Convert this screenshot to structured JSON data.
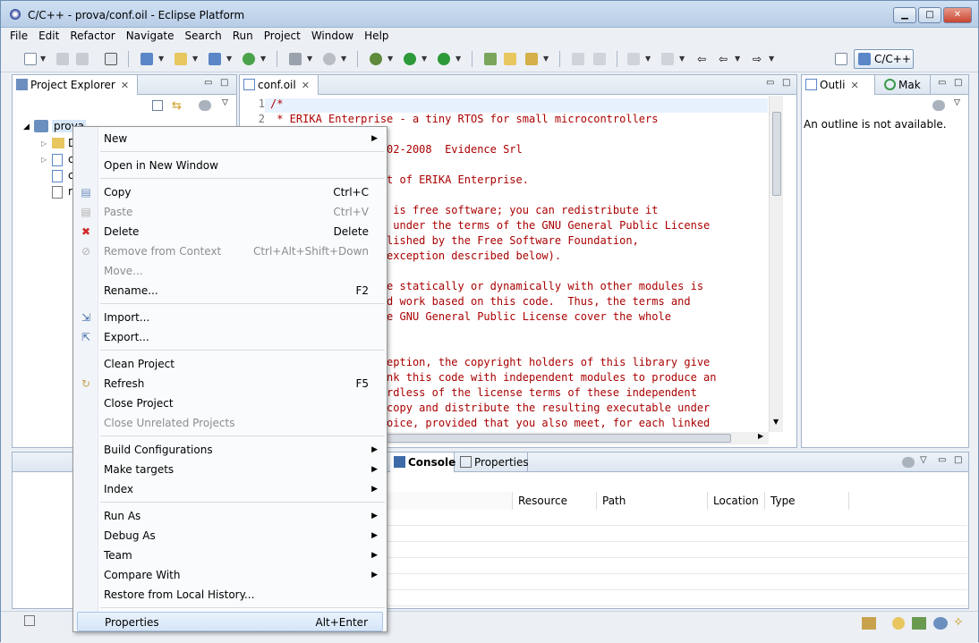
{
  "window": {
    "title": "C/C++ - prova/conf.oil - Eclipse Platform"
  },
  "menubar": [
    "File",
    "Edit",
    "Refactor",
    "Navigate",
    "Search",
    "Run",
    "Project",
    "Window",
    "Help"
  ],
  "toolbar": {
    "perspective_label": "C/C++"
  },
  "project_explorer": {
    "tab_label": "Project Explorer",
    "project_name": "prova",
    "children_initials": [
      "D",
      "c",
      "c",
      "r"
    ]
  },
  "editor": {
    "tab_label": "conf.oil",
    "line_numbers": [
      "1",
      "2"
    ],
    "lines": [
      "/*",
      " * ERIKA Enterprise - a tiny RTOS for small microcontrollers",
      "",
      "                2002-2008  Evidence Srl",
      "",
      "                art of ERIKA Enterprise.",
      "",
      "                se is free software; you can redistribute it",
      "                it under the terms of the GNU General Public License",
      "                ublished by the Free Software Foundation,",
      "                l exception described below).",
      "",
      "                ode statically or dynamically with other modules is",
      "                ned work based on this code.  Thus, the terms and",
      "                the GNU General Public License cover the whole",
      "",
      "",
      "                xception, the copyright holders of this library give",
      "                link this code with independent modules to produce an",
      "                gardless of the license terms of these independent",
      "                o copy and distribute the resulting executable under",
      "                choice, provided that you also meet, for each linked"
    ]
  },
  "outline": {
    "tab1_label": "Outli",
    "tab2_label": "Mak",
    "message": "An outline is not available."
  },
  "bottom": {
    "console_label": "Console",
    "properties_label": "Properties",
    "columns": [
      "Resource",
      "Path",
      "Location",
      "Type"
    ]
  },
  "context_menu": [
    {
      "label": "New",
      "shortcut": "",
      "submenu": true,
      "disabled": false,
      "icon": ""
    },
    {
      "sep": true
    },
    {
      "label": "Open in New Window",
      "shortcut": "",
      "submenu": false,
      "disabled": false,
      "icon": ""
    },
    {
      "sep": true
    },
    {
      "label": "Copy",
      "shortcut": "Ctrl+C",
      "submenu": false,
      "disabled": false,
      "icon": "copy-icon"
    },
    {
      "label": "Paste",
      "shortcut": "Ctrl+V",
      "submenu": false,
      "disabled": true,
      "icon": "paste-icon"
    },
    {
      "label": "Delete",
      "shortcut": "Delete",
      "submenu": false,
      "disabled": false,
      "icon": "delete-icon"
    },
    {
      "label": "Remove from Context",
      "shortcut": "Ctrl+Alt+Shift+Down",
      "submenu": false,
      "disabled": true,
      "icon": "remove-context-icon"
    },
    {
      "label": "Move...",
      "shortcut": "",
      "submenu": false,
      "disabled": true,
      "icon": ""
    },
    {
      "label": "Rename...",
      "shortcut": "F2",
      "submenu": false,
      "disabled": false,
      "icon": ""
    },
    {
      "sep": true
    },
    {
      "label": "Import...",
      "shortcut": "",
      "submenu": false,
      "disabled": false,
      "icon": "import-icon"
    },
    {
      "label": "Export...",
      "shortcut": "",
      "submenu": false,
      "disabled": false,
      "icon": "export-icon"
    },
    {
      "sep": true
    },
    {
      "label": "Clean Project",
      "shortcut": "",
      "submenu": false,
      "disabled": false,
      "icon": ""
    },
    {
      "label": "Refresh",
      "shortcut": "F5",
      "submenu": false,
      "disabled": false,
      "icon": "refresh-icon"
    },
    {
      "label": "Close Project",
      "shortcut": "",
      "submenu": false,
      "disabled": false,
      "icon": ""
    },
    {
      "label": "Close Unrelated Projects",
      "shortcut": "",
      "submenu": false,
      "disabled": true,
      "icon": ""
    },
    {
      "sep": true
    },
    {
      "label": "Build Configurations",
      "shortcut": "",
      "submenu": true,
      "disabled": false,
      "icon": ""
    },
    {
      "label": "Make targets",
      "shortcut": "",
      "submenu": true,
      "disabled": false,
      "icon": ""
    },
    {
      "label": "Index",
      "shortcut": "",
      "submenu": true,
      "disabled": false,
      "icon": ""
    },
    {
      "sep": true
    },
    {
      "label": "Run As",
      "shortcut": "",
      "submenu": true,
      "disabled": false,
      "icon": ""
    },
    {
      "label": "Debug As",
      "shortcut": "",
      "submenu": true,
      "disabled": false,
      "icon": ""
    },
    {
      "label": "Team",
      "shortcut": "",
      "submenu": true,
      "disabled": false,
      "icon": ""
    },
    {
      "label": "Compare With",
      "shortcut": "",
      "submenu": true,
      "disabled": false,
      "icon": ""
    },
    {
      "label": "Restore from Local History...",
      "shortcut": "",
      "submenu": false,
      "disabled": false,
      "icon": ""
    },
    {
      "sep": true
    },
    {
      "label": "Properties",
      "shortcut": "Alt+Enter",
      "submenu": false,
      "disabled": false,
      "icon": "",
      "selected": true
    }
  ],
  "colors": {
    "accent": "#3a6ea5",
    "comment": "#a00000",
    "selection": "#d6e6f8"
  }
}
